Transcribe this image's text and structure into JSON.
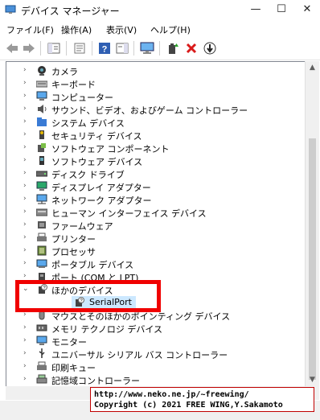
{
  "window": {
    "title": "デバイス マネージャー",
    "minimize": "—",
    "maximize": "☐",
    "close": "✕"
  },
  "menu": [
    "ファイル(F)",
    "操作(A)",
    "表示(V)",
    "ヘルプ(H)"
  ],
  "tree_items": [
    {
      "label": "カメラ",
      "icon": "camera-icon",
      "expanded": false
    },
    {
      "label": "キーボード",
      "icon": "keyboard-icon",
      "expanded": false
    },
    {
      "label": "コンピューター",
      "icon": "computer-icon",
      "expanded": false
    },
    {
      "label": "サウンド、ビデオ、およびゲーム コントローラー",
      "icon": "speaker-icon",
      "expanded": false
    },
    {
      "label": "システム デバイス",
      "icon": "folder-icon",
      "expanded": false
    },
    {
      "label": "セキュリティ デバイス",
      "icon": "security-key-icon",
      "expanded": false
    },
    {
      "label": "ソフトウェア コンポーネント",
      "icon": "component-icon",
      "expanded": false
    },
    {
      "label": "ソフトウェア デバイス",
      "icon": "software-device-icon",
      "expanded": false
    },
    {
      "label": "ディスク ドライブ",
      "icon": "disk-drive-icon",
      "expanded": false
    },
    {
      "label": "ディスプレイ アダプター",
      "icon": "display-adapter-icon",
      "expanded": false
    },
    {
      "label": "ネットワーク アダプター",
      "icon": "network-adapter-icon",
      "expanded": false
    },
    {
      "label": "ヒューマン インターフェイス デバイス",
      "icon": "hid-icon",
      "expanded": false
    },
    {
      "label": "ファームウェア",
      "icon": "firmware-icon",
      "expanded": false
    },
    {
      "label": "プリンター",
      "icon": "printer-icon",
      "expanded": false
    },
    {
      "label": "プロセッサ",
      "icon": "processor-icon",
      "expanded": false
    },
    {
      "label": "ポータブル デバイス",
      "icon": "portable-device-icon",
      "expanded": false
    },
    {
      "label": "ポート (COM と LPT)",
      "icon": "port-icon",
      "expanded": false
    },
    {
      "label": "ほかのデバイス",
      "icon": "unknown-device-icon",
      "expanded": true
    },
    {
      "label": "SerialPort",
      "icon": "unknown-device-icon",
      "child": true
    },
    {
      "label": "マウスとそのほかのポインティング デバイス",
      "icon": "mouse-icon",
      "expanded": false
    },
    {
      "label": "メモリ テクノロジ デバイス",
      "icon": "memory-icon",
      "expanded": false
    },
    {
      "label": "モニター",
      "icon": "monitor-icon",
      "expanded": false
    },
    {
      "label": "ユニバーサル シリアル バス コントローラー",
      "icon": "usb-icon",
      "expanded": false
    },
    {
      "label": "印刷キュー",
      "icon": "print-queue-icon",
      "expanded": false
    },
    {
      "label": "記憶域コントローラー",
      "icon": "storage-controller-icon",
      "expanded": false
    }
  ],
  "copyright": {
    "line1": "http://www.neko.ne.jp/~freewing/",
    "line2": "Copyright (c) 2021 FREE WING,Y.Sakamoto"
  },
  "colors": {
    "highlight": "#f00000",
    "selection": "#cce8ff"
  }
}
